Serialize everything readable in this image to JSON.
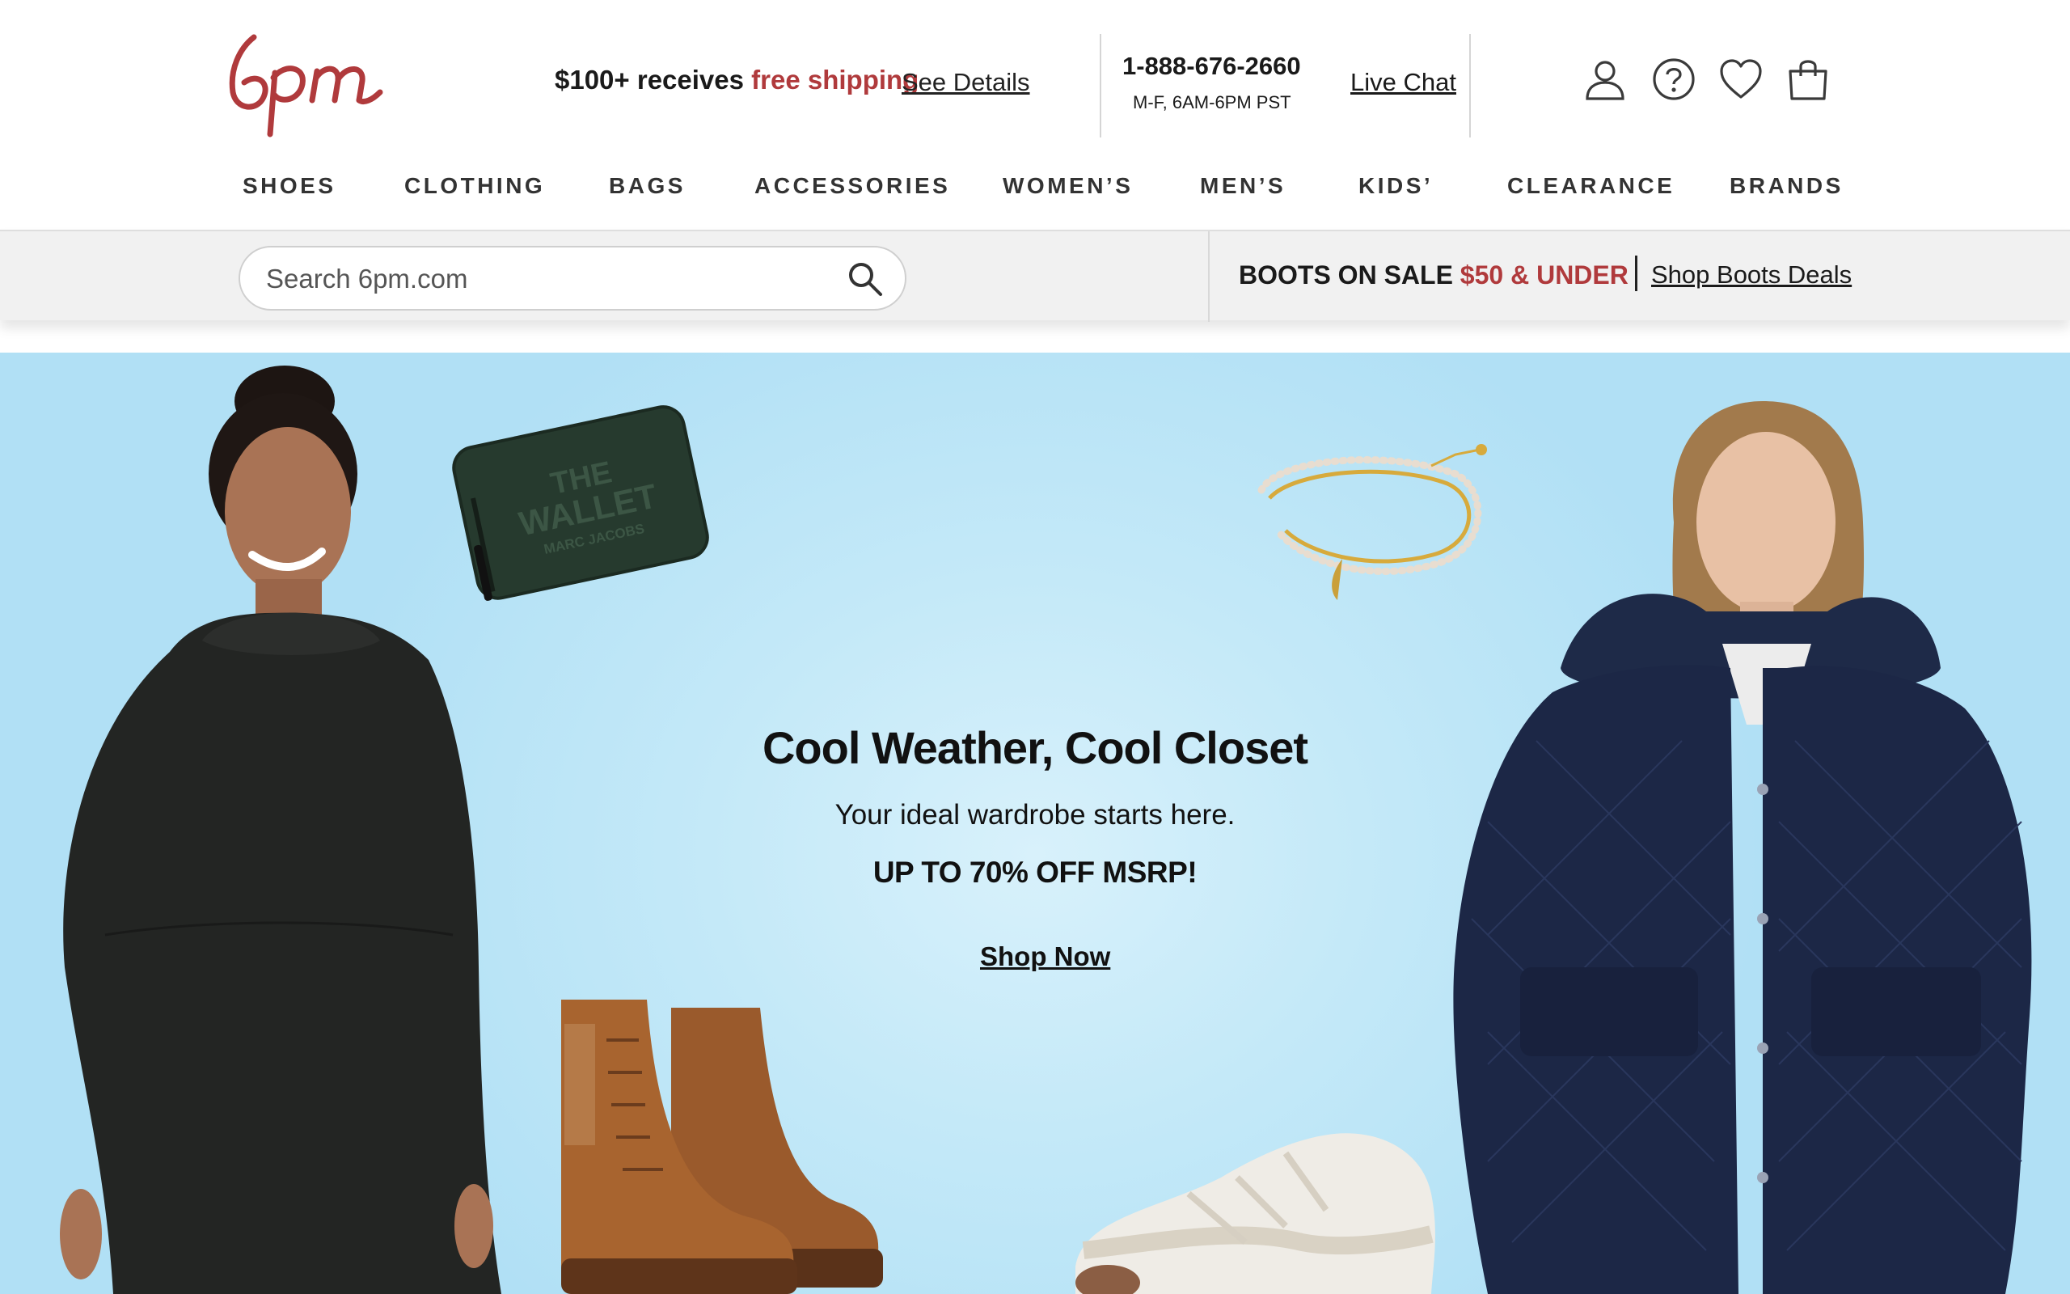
{
  "brand": {
    "logo_text": "6pm",
    "logo_color": "#b03a3c"
  },
  "header": {
    "shipping_prefix": "$100+ receives ",
    "shipping_highlight": "free shipping",
    "see_details": "See Details",
    "phone": "1-888-676-2660",
    "hours": "M-F, 6AM-6PM PST",
    "live_chat": "Live Chat",
    "icons": [
      "account-icon",
      "help-icon",
      "favorites-heart-icon",
      "shopping-bag-icon"
    ]
  },
  "nav": {
    "items": [
      "SHOES",
      "CLOTHING",
      "BAGS",
      "ACCESSORIES",
      "WOMEN’S",
      "MEN’S",
      "KIDS’",
      "CLEARANCE",
      "BRANDS"
    ]
  },
  "search": {
    "placeholder": "Search 6pm.com",
    "value": ""
  },
  "promo_strip": {
    "prefix": "BOOTS ON SALE ",
    "highlight": "$50 & UNDER",
    "link": "Shop Boots Deals"
  },
  "hero": {
    "title": "Cool Weather, Cool Closet",
    "subtitle": "Your ideal wardrobe starts here.",
    "offer": "UP TO 70% OFF MSRP!",
    "cta": "Shop Now",
    "wallet_text_line1": "THE",
    "wallet_text_line2": "WALLET",
    "wallet_brand": "MARC JACOBS"
  },
  "colors": {
    "accent": "#b03a3c",
    "hero_bg": "#b1e0f5",
    "strip_bg": "#f1f1f1"
  }
}
